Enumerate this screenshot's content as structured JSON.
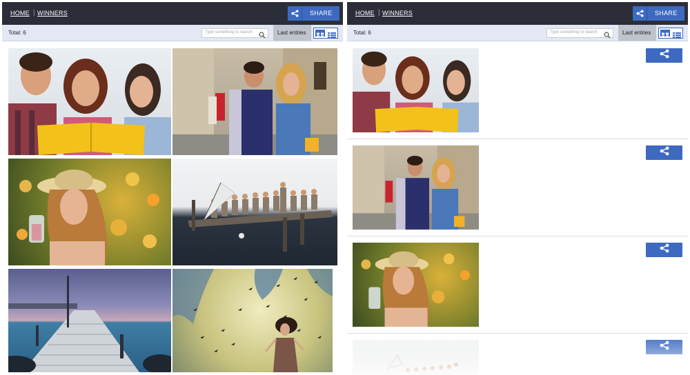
{
  "nav": {
    "home": "HOME",
    "separator": "|",
    "winners": "WINNERS"
  },
  "share_button": {
    "label": "SHARE",
    "icon": "share-icon"
  },
  "toolbar": {
    "total": "Total: 6",
    "search_placeholder": "Type something to search",
    "sort": "Last entries",
    "view_grid_icon": "grid-view-icon",
    "view_list_icon": "list-view-icon"
  },
  "colors": {
    "topbar": "#2b2e39",
    "accent": "#3d6ac0",
    "subbar": "#e3e8f4"
  },
  "photos": [
    {
      "subject": "three friends reading yellow book"
    },
    {
      "subject": "couple walking street with shopping bags"
    },
    {
      "subject": "woman in straw hat with flowers"
    },
    {
      "subject": "people sitting on dock over water"
    },
    {
      "subject": "long wooden pier at sunset"
    },
    {
      "subject": "girl running with flock of birds"
    }
  ]
}
